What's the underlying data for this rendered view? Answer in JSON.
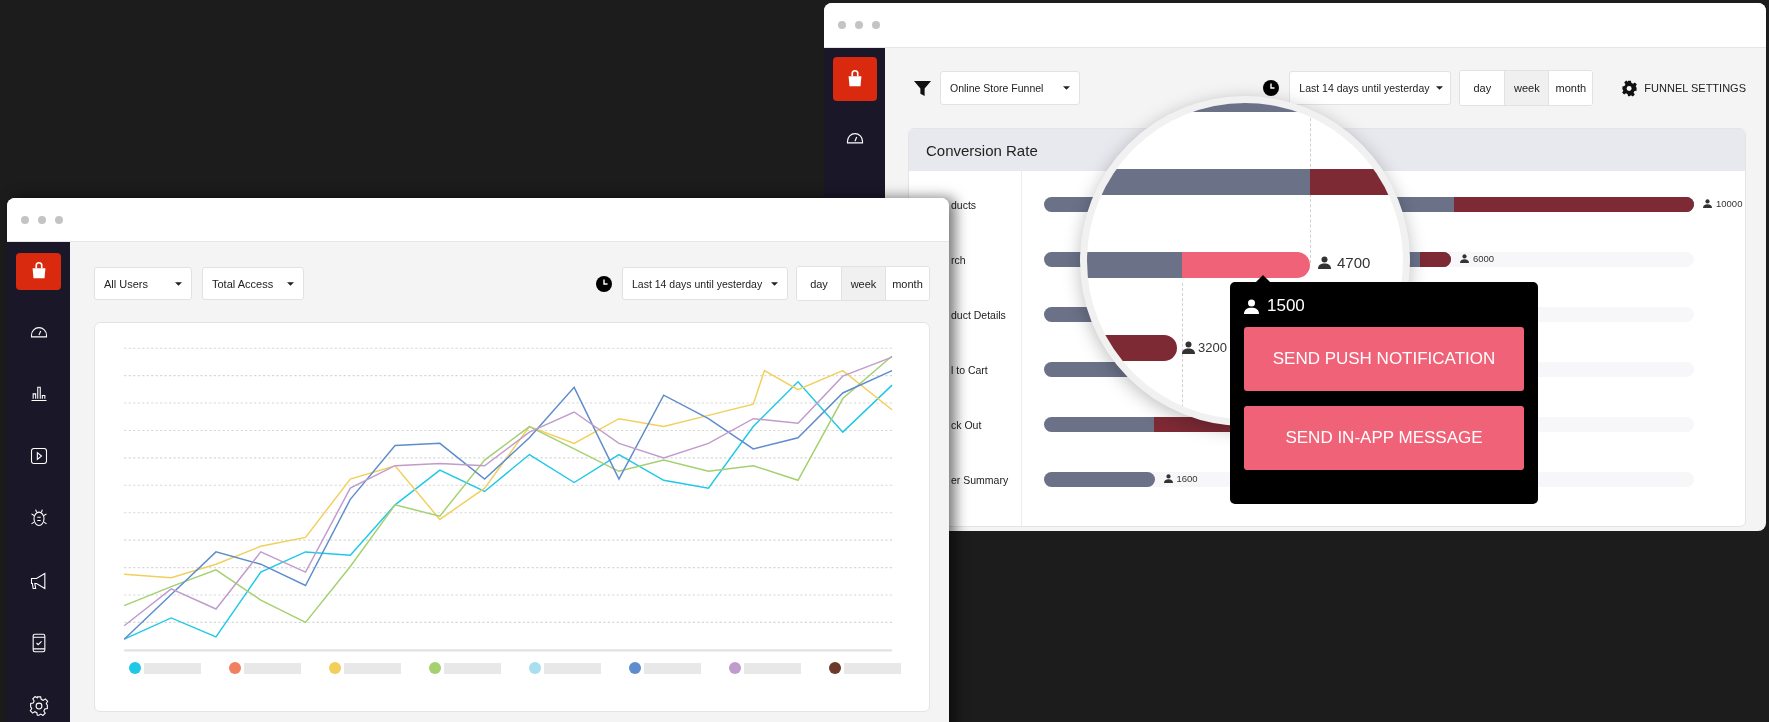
{
  "back_window": {
    "funnel": "Online Store Funnel",
    "date_range": "Last 14 days until yesterday",
    "granularity": [
      {
        "label": "day",
        "selected": false
      },
      {
        "label": "week",
        "selected": true
      },
      {
        "label": "month",
        "selected": false
      }
    ],
    "settings_button": "FUNNEL SETTINGS",
    "conversion": {
      "title": "Conversion Rate",
      "steps": [
        {
          "label": "ducts",
          "level": 1.0,
          "dropped": {
            "level": 0.37
          },
          "count": "10000"
        },
        {
          "label": "rch",
          "level": 0.626,
          "dropped": {
            "level": 0.077
          },
          "count": "6000"
        },
        {
          "label": "duct Details",
          "level": 0.45
        },
        {
          "label": "l to Cart",
          "level": 0.35
        },
        {
          "label": "ck Out",
          "level": 0.47,
          "dropped": {
            "level": 0.64
          }
        },
        {
          "label": "er Summary",
          "level": 0.17,
          "count": "1600"
        }
      ]
    },
    "magnifier": {
      "counts": [
        "4700",
        "3200"
      ]
    },
    "popover": {
      "count": "1500",
      "actions": [
        "SEND PUSH NOTIFICATION",
        "SEND IN-APP MESSAGE"
      ]
    }
  },
  "front_window": {
    "filters": [
      "All Users",
      "Total Access"
    ],
    "date_range": "Last 14 days until yesterday",
    "granularity": [
      {
        "label": "day",
        "selected": false
      },
      {
        "label": "week",
        "selected": true
      },
      {
        "label": "month",
        "selected": false
      }
    ],
    "legend": [
      {
        "color": "#1ec8e6"
      },
      {
        "color": "#f08060"
      },
      {
        "color": "#f2cf5b"
      },
      {
        "color": "#a4d070"
      },
      {
        "color": "#a8dff0"
      },
      {
        "color": "#5f8ccc"
      },
      {
        "color": "#c09ccc"
      },
      {
        "color": "#6b3a2a"
      }
    ]
  }
}
